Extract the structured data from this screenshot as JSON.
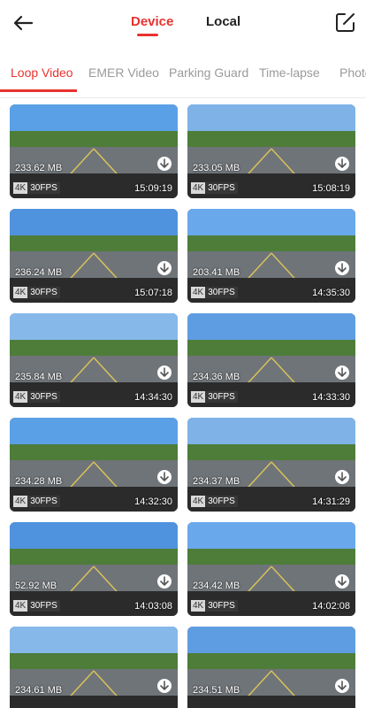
{
  "header": {
    "segments": [
      "Device",
      "Local"
    ],
    "active_segment": "Device",
    "back_icon": "back-arrow-icon",
    "edit_icon": "edit-icon"
  },
  "tabs": [
    "Loop Video",
    "EMER Video",
    "Parking Guard",
    "Time-lapse",
    "Photo"
  ],
  "active_tab": "Loop Video",
  "colors": {
    "accent": "#e8322e"
  },
  "videos": [
    {
      "size": "233.62 MB",
      "res": "4K",
      "fps": "30FPS",
      "time": "15:09:19"
    },
    {
      "size": "233.05 MB",
      "res": "4K",
      "fps": "30FPS",
      "time": "15:08:19"
    },
    {
      "size": "236.24 MB",
      "res": "4K",
      "fps": "30FPS",
      "time": "15:07:18"
    },
    {
      "size": "203.41 MB",
      "res": "4K",
      "fps": "30FPS",
      "time": "14:35:30"
    },
    {
      "size": "235.84 MB",
      "res": "4K",
      "fps": "30FPS",
      "time": "14:34:30"
    },
    {
      "size": "234.36 MB",
      "res": "4K",
      "fps": "30FPS",
      "time": "14:33:30"
    },
    {
      "size": "234.28 MB",
      "res": "4K",
      "fps": "30FPS",
      "time": "14:32:30"
    },
    {
      "size": "234.37 MB",
      "res": "4K",
      "fps": "30FPS",
      "time": "14:31:29"
    },
    {
      "size": "52.92 MB",
      "res": "4K",
      "fps": "30FPS",
      "time": "14:03:08"
    },
    {
      "size": "234.42 MB",
      "res": "4K",
      "fps": "30FPS",
      "time": "14:02:08"
    },
    {
      "size": "234.61 MB",
      "res": "",
      "fps": "",
      "time": ""
    },
    {
      "size": "234.51 MB",
      "res": "",
      "fps": "",
      "time": ""
    }
  ]
}
